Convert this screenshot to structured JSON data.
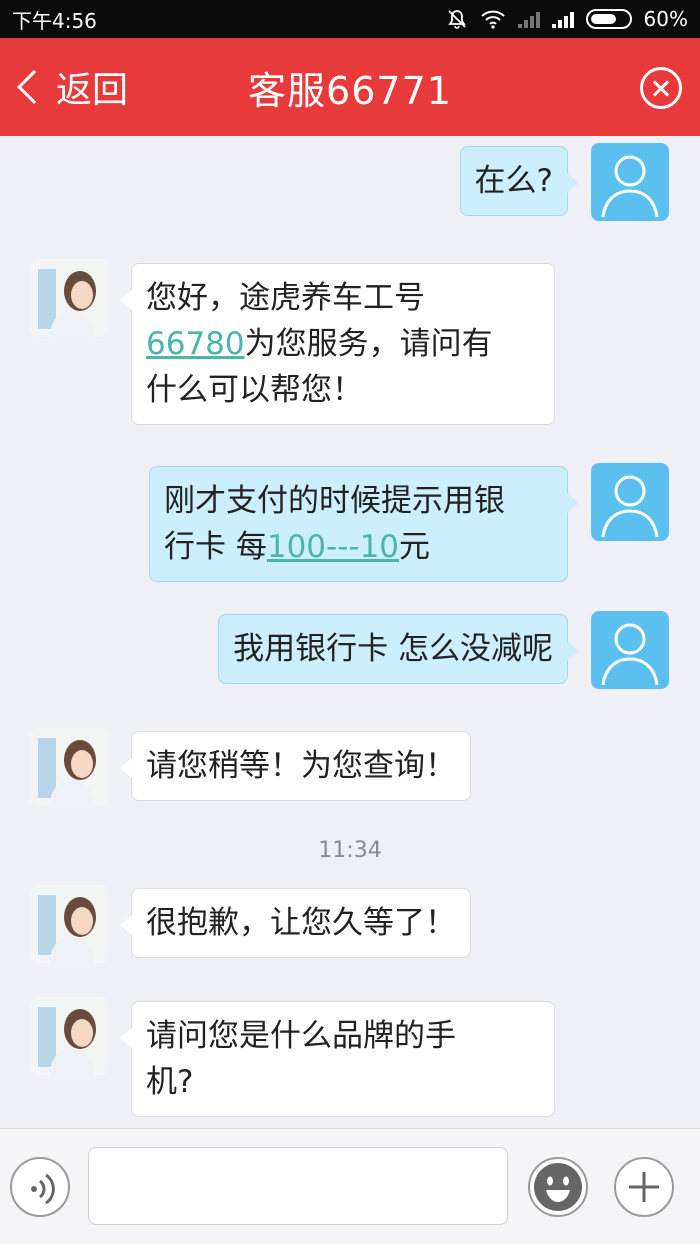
{
  "status_bar": {
    "time": "下午4:56",
    "battery": "60%"
  },
  "header": {
    "back_label": "返回",
    "title": "客服66771"
  },
  "messages": [
    {
      "from": "user",
      "text": "在么?"
    },
    {
      "from": "agent",
      "line1": "您好，途虎养车工号",
      "line2_link": "66780",
      "line2_rest": "为您服务，请问有",
      "line3": "什么可以帮您！"
    },
    {
      "from": "user",
      "line1": "刚才支付的时候提示用银",
      "line2_pre": "行卡 每",
      "line2_link": "100---10",
      "line2_post": "元"
    },
    {
      "from": "user",
      "text": "我用银行卡 怎么没减呢"
    },
    {
      "from": "agent",
      "text": "请您稍等！为您查询！"
    },
    {
      "from": "agent",
      "text": "很抱歉，让您久等了！"
    },
    {
      "from": "agent",
      "line1": "请问您是什么品牌的手",
      "line2": "机?"
    }
  ],
  "timestamp": "11:34",
  "input": {
    "placeholder": ""
  }
}
